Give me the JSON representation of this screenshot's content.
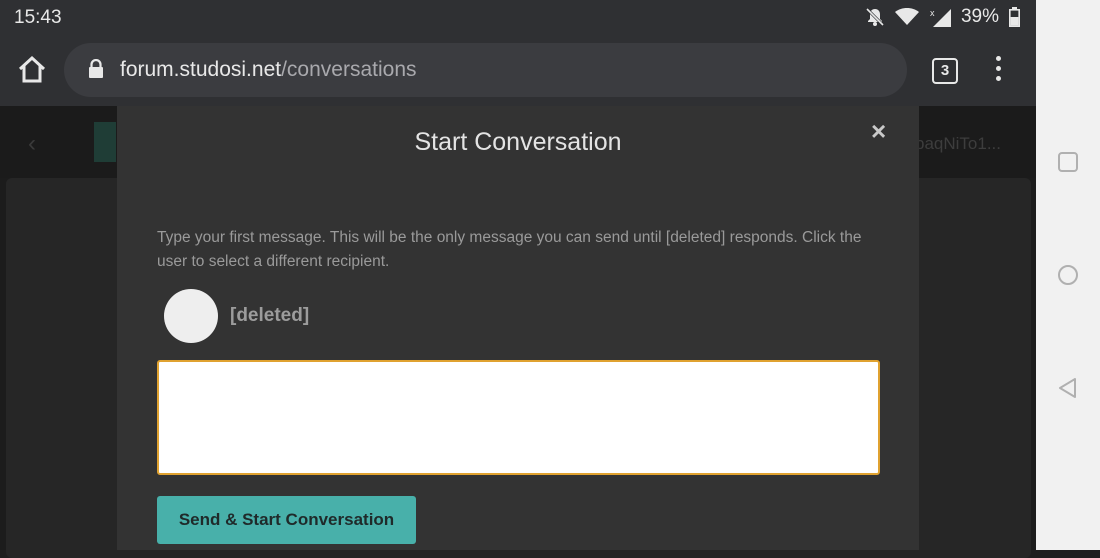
{
  "status_bar": {
    "time": "15:43",
    "battery": "39%",
    "icons": [
      "notifications-off-icon",
      "wifi-icon",
      "signal-icon",
      "battery-icon"
    ]
  },
  "browser": {
    "url_domain": "forum.studosi.net",
    "url_path": "/conversations",
    "tab_count": "3",
    "icons": [
      "home-icon",
      "lock-icon",
      "tabs-icon",
      "overflow-menu-icon"
    ]
  },
  "modal": {
    "title": "Start Conversation",
    "close_label": "×",
    "description": "Type your first message. This will be the only message you can send until [deleted] responds. Click the user to select a different recipient.",
    "recipient_name": "[deleted]",
    "message_value": "",
    "send_label": "Send & Start Conversation"
  },
  "background_page": {
    "user_text": "baqNiTo1..."
  },
  "colors": {
    "accent": "#48b0aa",
    "input_border": "#e0a230",
    "modal_bg": "#333333",
    "chrome_bg": "#2f3033"
  },
  "nav_bar": {
    "icons": [
      "recents-icon",
      "home-circle-icon",
      "back-icon"
    ]
  }
}
